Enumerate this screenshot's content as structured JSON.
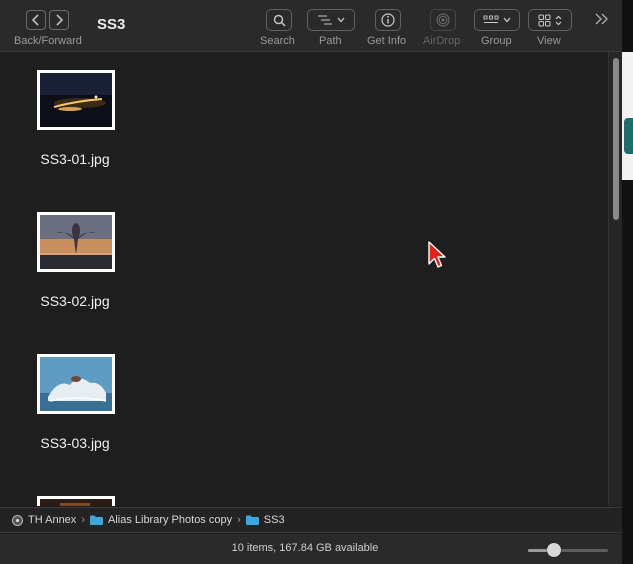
{
  "toolbar": {
    "nav_label": "Back/Forward",
    "title": "SS3",
    "search_label": "Search",
    "path_label": "Path",
    "getinfo_label": "Get Info",
    "airdrop_label": "AirDrop",
    "group_label": "Group",
    "view_label": "View"
  },
  "items": [
    {
      "name": "SS3-01.jpg"
    },
    {
      "name": "SS3-02.jpg"
    },
    {
      "name": "SS3-03.jpg"
    }
  ],
  "pathbar": {
    "crumbs": [
      "TH Annex",
      "Alias Library Photos copy",
      "SS3"
    ],
    "separator": "›"
  },
  "status": {
    "text": "10 items, 167.84 GB available",
    "icon_size_fraction": 0.33
  },
  "colors": {
    "accent_folder": "#3aa7e0",
    "cursor": "#e3231b"
  }
}
